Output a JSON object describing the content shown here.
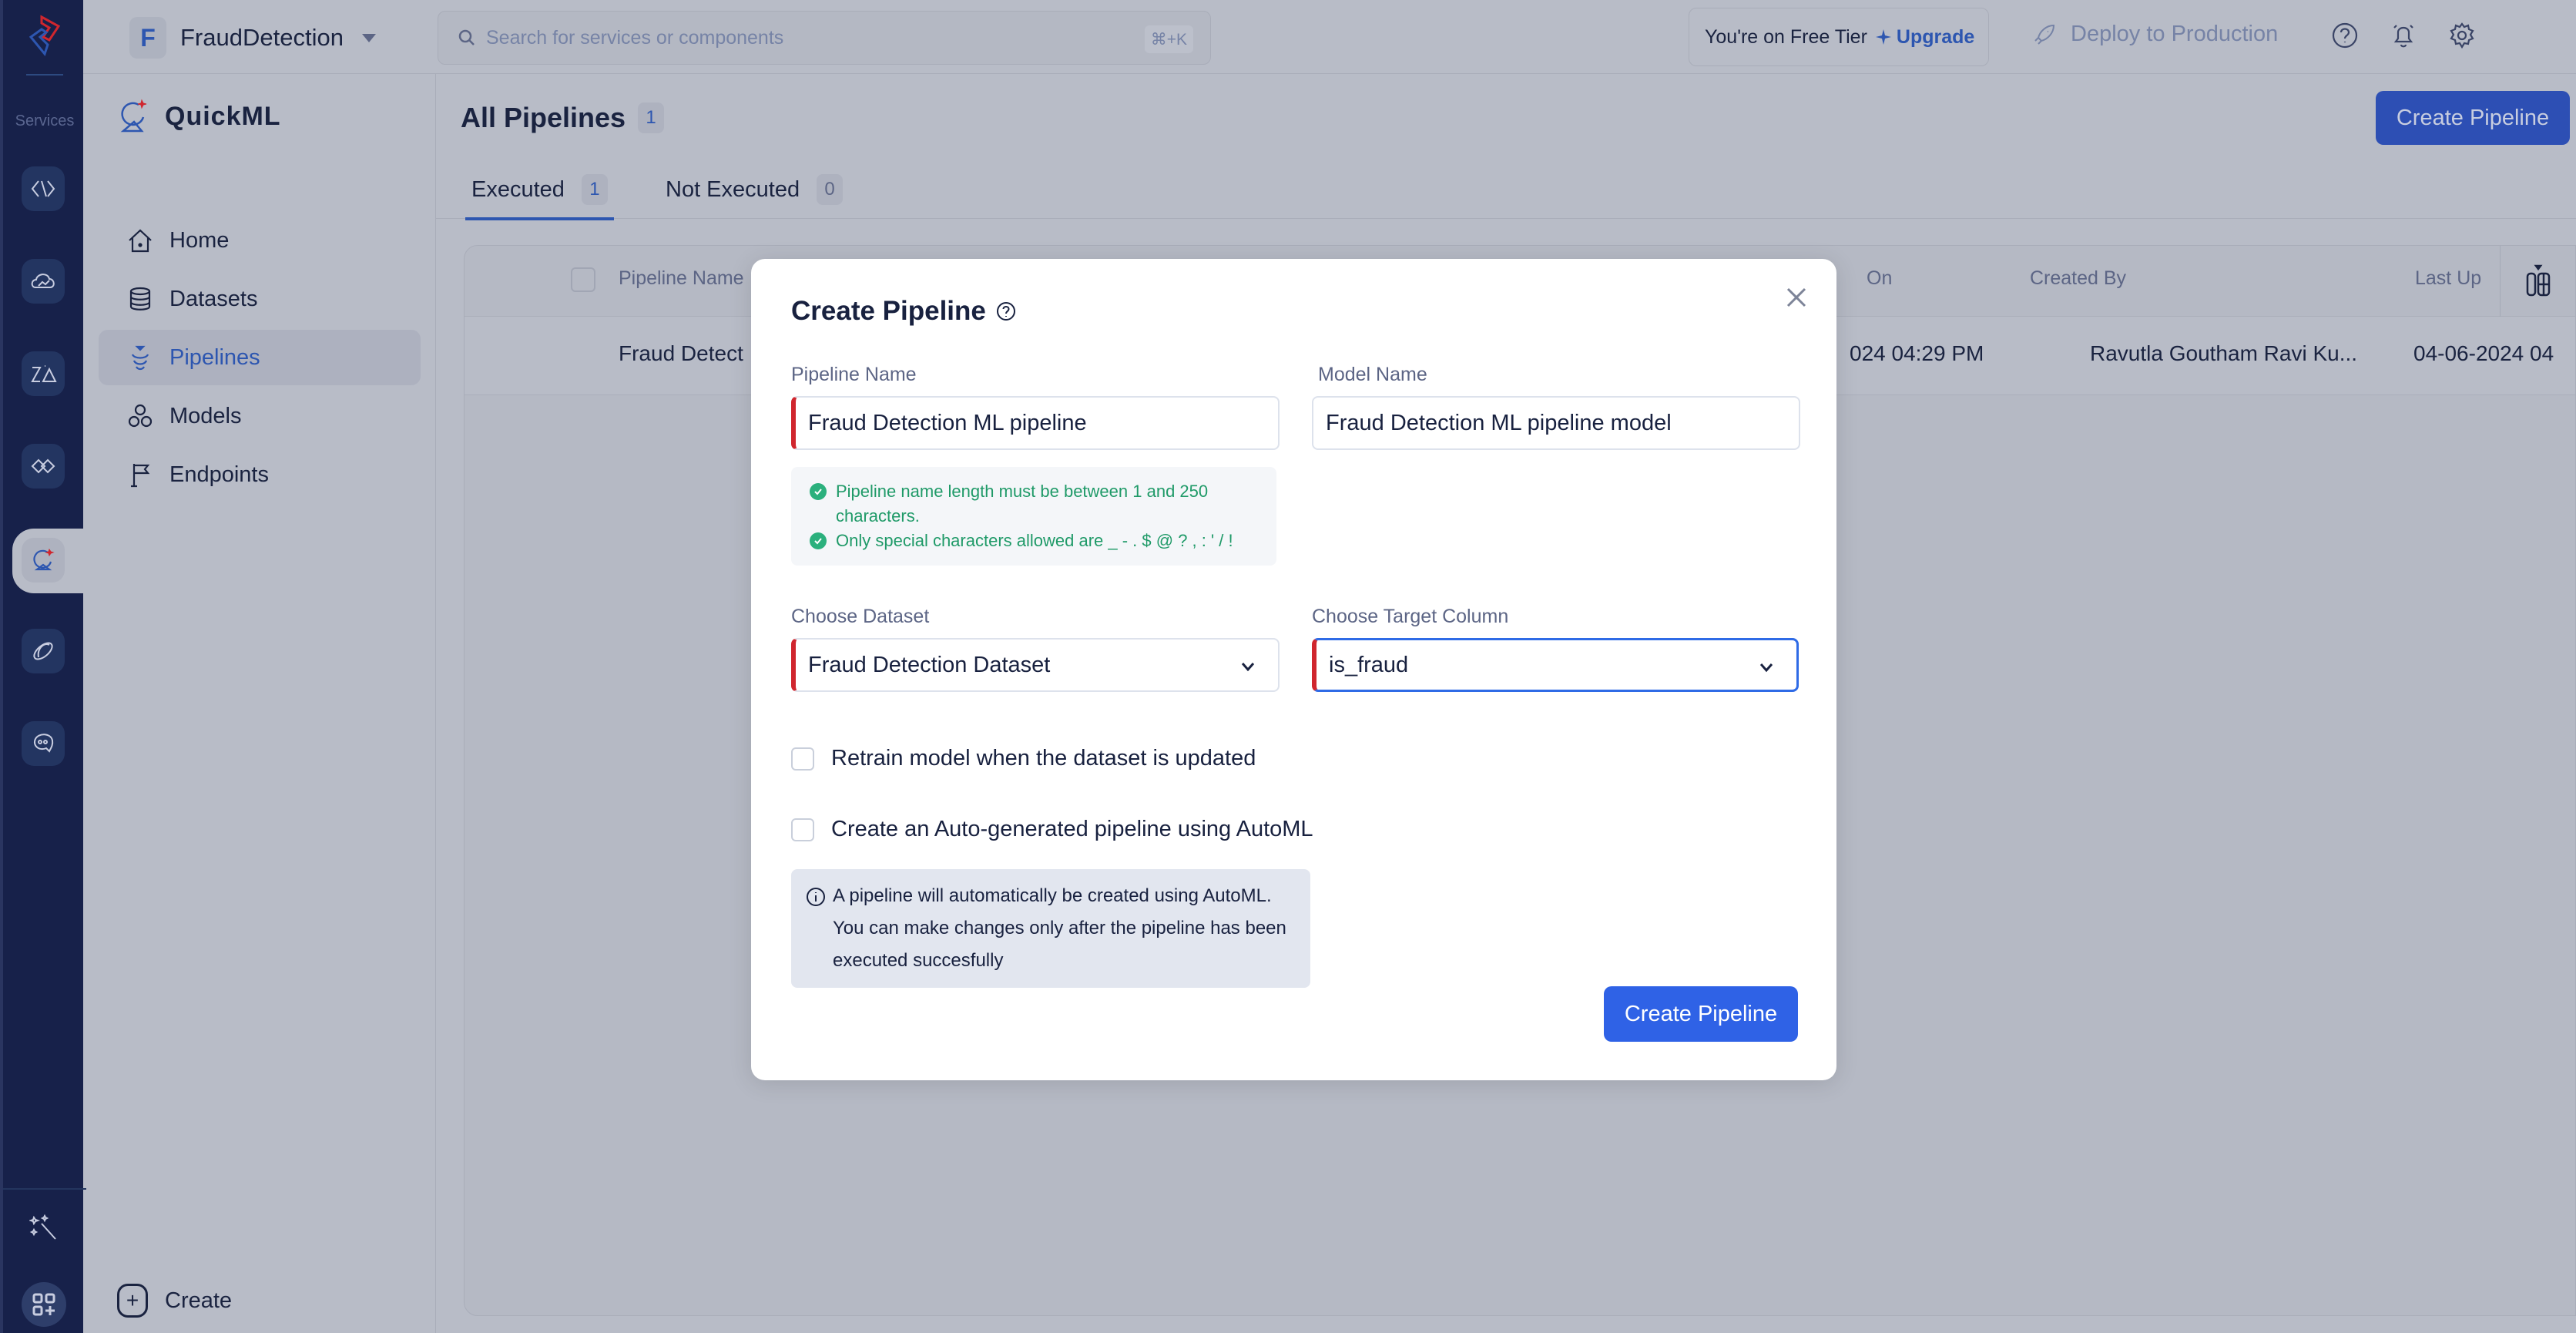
{
  "rail": {
    "services_label": "Services",
    "icons": [
      "code-brackets-icon",
      "cloud-analytics-icon",
      "zia-icon",
      "handshake-icon",
      "quickml-icon",
      "link-orbit-icon",
      "chat-bot-icon"
    ],
    "bottom_icons": [
      "magic-wand-icon",
      "apps-add-icon"
    ]
  },
  "topbar": {
    "project_initial": "F",
    "project_name": "FraudDetection",
    "search_placeholder": "Search for services or components",
    "search_shortcut": "⌘+K",
    "tier_text": "You're on Free Tier",
    "upgrade_label": "Upgrade",
    "deploy_label": "Deploy to Production"
  },
  "sidebar": {
    "brand": "QuickML",
    "items": [
      {
        "label": "Home",
        "icon": "home-icon",
        "active": false
      },
      {
        "label": "Datasets",
        "icon": "database-icon",
        "active": false
      },
      {
        "label": "Pipelines",
        "icon": "pipeline-icon",
        "active": true
      },
      {
        "label": "Models",
        "icon": "models-icon",
        "active": false
      },
      {
        "label": "Endpoints",
        "icon": "flag-icon",
        "active": false
      }
    ],
    "create_label": "Create"
  },
  "main": {
    "title": "All Pipelines",
    "title_count": "1",
    "create_button": "Create Pipeline",
    "tabs": [
      {
        "label": "Executed",
        "count": "1",
        "active": true
      },
      {
        "label": "Not Executed",
        "count": "0",
        "active": false
      }
    ],
    "table": {
      "columns": [
        "Pipeline Name",
        "On",
        "Created By",
        "Last Up"
      ],
      "rows": [
        {
          "name": "Fraud Detect",
          "created_on": "024 04:29 PM",
          "created_by": "Ravutla Goutham Ravi Ku...",
          "last_updated": "04-06-2024 04"
        }
      ]
    }
  },
  "modal": {
    "title": "Create Pipeline",
    "pipeline_name_label": "Pipeline Name",
    "pipeline_name_value": "Fraud Detection ML pipeline",
    "model_name_label": "Model Name",
    "model_name_value": "Fraud Detection ML pipeline model",
    "hints": [
      "Pipeline name length must be between 1 and 250 characters.",
      "Only special characters allowed are _ - . $ @ ? , : ' / !"
    ],
    "dataset_label": "Choose Dataset",
    "dataset_value": "Fraud Detection Dataset",
    "target_label": "Choose Target Column",
    "target_value": "is_fraud",
    "retrain_label": "Retrain model when the dataset is updated",
    "retrain_checked": false,
    "automl_label": "Create an Auto-generated pipeline using AutoML",
    "automl_checked": false,
    "info_text": "A pipeline will automatically be created using AutoML. You can make changes only after the pipeline has been executed succesfully",
    "submit_label": "Create Pipeline"
  },
  "colors": {
    "accent": "#2f62e6",
    "rail_bg": "#17214a",
    "error": "#d0262e",
    "success": "#1f9a68",
    "overlay_bg": "#b8bcc7"
  }
}
